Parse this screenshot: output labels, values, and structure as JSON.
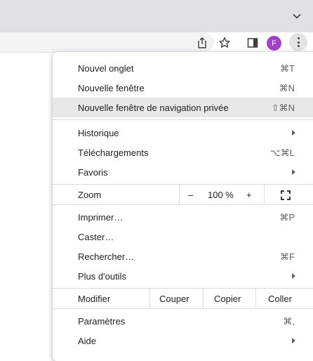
{
  "browser": {
    "avatar_initial": "F",
    "accent_color": "#a142c6"
  },
  "menu": {
    "new_tab": {
      "label": "Nouvel onglet",
      "shortcut": "⌘T"
    },
    "new_window": {
      "label": "Nouvelle fenêtre",
      "shortcut": "⌘N"
    },
    "incognito": {
      "label": "Nouvelle fenêtre de navigation privée",
      "shortcut": "⇧⌘N"
    },
    "history": {
      "label": "Historique"
    },
    "downloads": {
      "label": "Téléchargements",
      "shortcut": "⌥⌘L"
    },
    "bookmarks": {
      "label": "Favoris"
    },
    "zoom": {
      "label": "Zoom",
      "minus": "–",
      "value": "100 %",
      "plus": "+"
    },
    "print": {
      "label": "Imprimer…",
      "shortcut": "⌘P"
    },
    "cast": {
      "label": "Caster…"
    },
    "find": {
      "label": "Rechercher…",
      "shortcut": "⌘F"
    },
    "more_tools": {
      "label": "Plus d'outils"
    },
    "edit": {
      "label": "Modifier",
      "cut": "Couper",
      "copy": "Copier",
      "paste": "Coller"
    },
    "settings": {
      "label": "Paramètres",
      "shortcut": "⌘,"
    },
    "help": {
      "label": "Aide"
    }
  }
}
